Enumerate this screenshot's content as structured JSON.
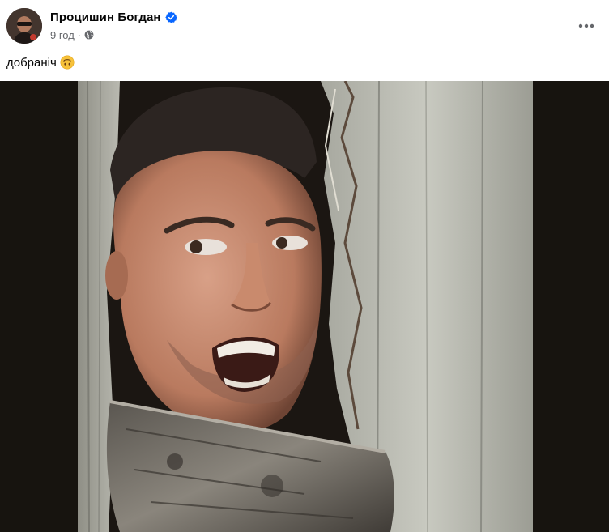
{
  "post": {
    "author": "Процишин Богдан",
    "verified": true,
    "time": "9 год",
    "separator": "·",
    "privacy_icon": "globe-icon",
    "text": "добраніч",
    "emoji": "upside-down-face-emoji",
    "more_icon": "more-horizontal-icon"
  },
  "colors": {
    "verified_blue": "#0866ff",
    "meta_gray": "#65676b",
    "media_bg": "#17140f"
  }
}
